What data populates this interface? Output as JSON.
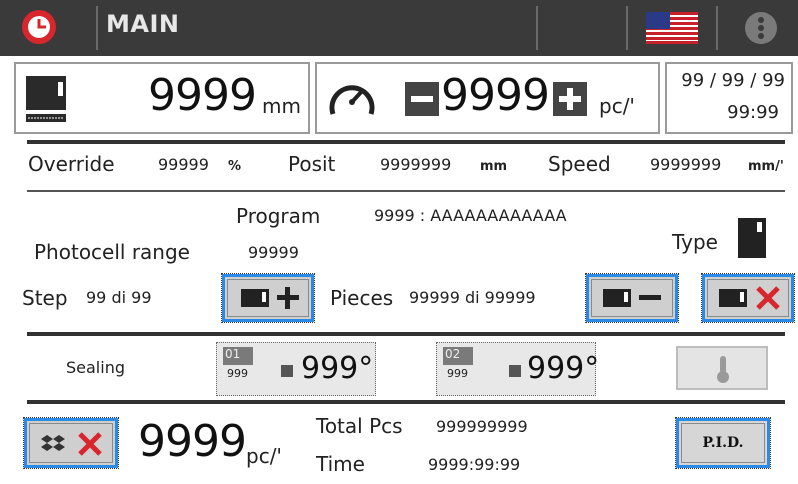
{
  "header": {
    "title": "MAIN",
    "icons": [
      "clock-icon",
      "us-flag-icon",
      "menu-icon"
    ],
    "colors": {
      "bar": "#3a3a3a",
      "accent_red": "#d8262c",
      "button_blue": "#2a8ae6"
    }
  },
  "status": {
    "length_value": "9999",
    "length_unit": "mm",
    "speed_value": "9999",
    "speed_unit": "pc/'",
    "date": "99 / 99 / 99",
    "time": "99:99"
  },
  "info_row": {
    "override_label": "Override",
    "override_value": "99999",
    "override_unit": "%",
    "posit_label": "Posit",
    "posit_value": "9999999",
    "posit_unit": "mm",
    "speed_label": "Speed",
    "speed_value": "9999999",
    "speed_unit": "mm/'"
  },
  "program": {
    "program_label": "Program",
    "program_value": "9999 : AAAAAAAAAAAA",
    "photocell_label": "Photocell range",
    "photocell_value": "99999",
    "type_label": "Type",
    "step_label": "Step",
    "step_value": "99 di 99",
    "pieces_label": "Pieces",
    "pieces_value": "99999 di 99999"
  },
  "sealing": {
    "label": "Sealing",
    "zones": [
      {
        "tag": "01",
        "setpoint": "999",
        "value": "999°"
      },
      {
        "tag": "02",
        "setpoint": "999",
        "value": "999°"
      }
    ]
  },
  "totals": {
    "counter_value": "9999",
    "counter_unit": "pc/'",
    "total_label": "Total Pcs",
    "total_value": "999999999",
    "time_label": "Time",
    "time_value": "9999:99:99",
    "pid_label": "P.I.D."
  }
}
